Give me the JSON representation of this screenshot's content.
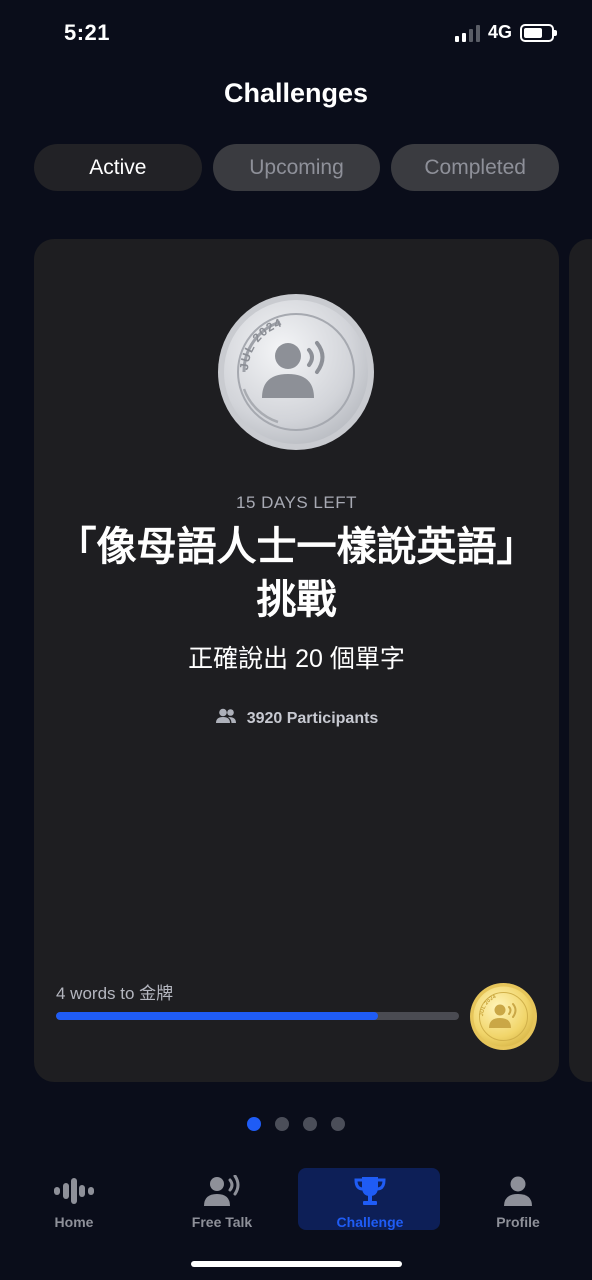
{
  "status_bar": {
    "time": "5:21",
    "network": "4G"
  },
  "header": {
    "title": "Challenges"
  },
  "tabs": [
    {
      "label": "Active",
      "state": "active"
    },
    {
      "label": "Upcoming",
      "state": "inactive"
    },
    {
      "label": "Completed",
      "state": "inactive"
    }
  ],
  "card": {
    "medal_text": "JUL 2024",
    "days_left": "15 DAYS LEFT",
    "title": "「像母語人士一樣說英語」挑戰",
    "goal": "正確說出 20 個單字",
    "participants": "3920 Participants",
    "progress_label": "4 words to 金牌",
    "progress_fraction": 0.8,
    "gold_medal_text": "JUL 2024"
  },
  "pager": {
    "count": 4,
    "current": 1
  },
  "nav": {
    "items": [
      {
        "label": "Home",
        "icon": "waveform-icon"
      },
      {
        "label": "Free Talk",
        "icon": "speaking-person-icon"
      },
      {
        "label": "Challenge",
        "icon": "trophy-icon",
        "selected": true
      },
      {
        "label": "Profile",
        "icon": "person-icon"
      }
    ]
  },
  "colors": {
    "accent": "#1f5cf5",
    "background": "#0a0d1a",
    "card": "#1e1e21"
  }
}
